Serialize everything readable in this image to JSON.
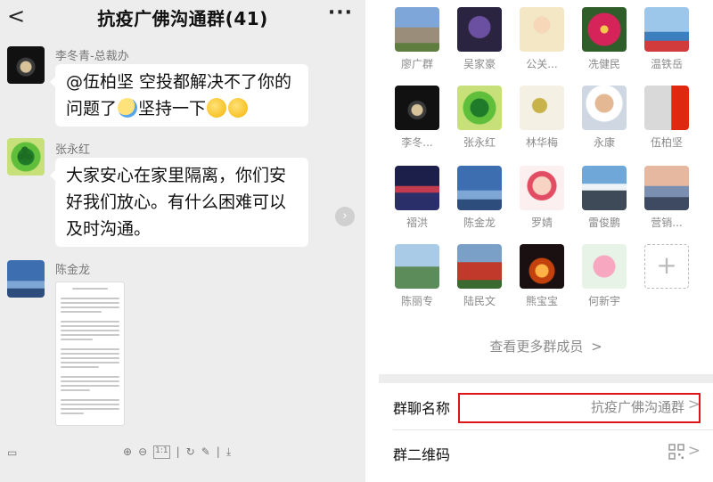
{
  "chat": {
    "title": "抗疫广佛沟通群(41)",
    "back_glyph": "<",
    "more_glyph": "···",
    "messages": [
      {
        "sender": "李冬青-总裁办",
        "text_line1": "@伍柏坚  空投都解决不了你的",
        "text_line2": "问题了",
        "text_line2b": "坚持一下"
      },
      {
        "sender": "张永红",
        "text_line1": "大家安心在家里隔离，你们安",
        "text_line2": "好我们放心。有什么困难可以",
        "text_line3": "及时沟通。"
      },
      {
        "sender": "陈金龙"
      }
    ],
    "toolbar_icons": [
      "zoom-in-icon",
      "zoom-out-icon",
      "fit-page-icon",
      "rotate-icon",
      "edit-icon",
      "download-icon"
    ],
    "toolbar_page": "1:1"
  },
  "group_info": {
    "members": [
      {
        "name": "廖广群",
        "avatar": "castle"
      },
      {
        "name": "吴家豪",
        "avatar": "anime"
      },
      {
        "name": "公关...",
        "avatar": "cartoon"
      },
      {
        "name": "冼健民",
        "avatar": "flower-red"
      },
      {
        "name": "温铁岳",
        "avatar": "person-sea"
      },
      {
        "name": "李冬...",
        "avatar": "dark-lens"
      },
      {
        "name": "张永红",
        "avatar": "clover"
      },
      {
        "name": "林华梅",
        "avatar": "fairy"
      },
      {
        "name": "永康",
        "avatar": "man-portrait"
      },
      {
        "name": "伍柏坚",
        "avatar": "man-flag"
      },
      {
        "name": "褶洪",
        "avatar": "city-night"
      },
      {
        "name": "陈金龙",
        "avatar": "bird-sky"
      },
      {
        "name": "罗婧",
        "avatar": "girl-cartoon"
      },
      {
        "name": "雷俊鹏",
        "avatar": "mountain"
      },
      {
        "name": "营销...",
        "avatar": "sunset-person"
      },
      {
        "name": "陈丽专",
        "avatar": "landscape-blue"
      },
      {
        "name": "陆民文",
        "avatar": "man-red"
      },
      {
        "name": "熊宝宝",
        "avatar": "fire-night"
      },
      {
        "name": "何新宇",
        "avatar": "lotus"
      }
    ],
    "add_glyph": "+",
    "see_more": "查看更多群成员",
    "chevron": ">",
    "rows": {
      "group_name_label": "群聊名称",
      "group_name_value": "抗疫广佛沟通群",
      "qr_label": "群二维码"
    },
    "highlight_color": "#e0121a"
  }
}
